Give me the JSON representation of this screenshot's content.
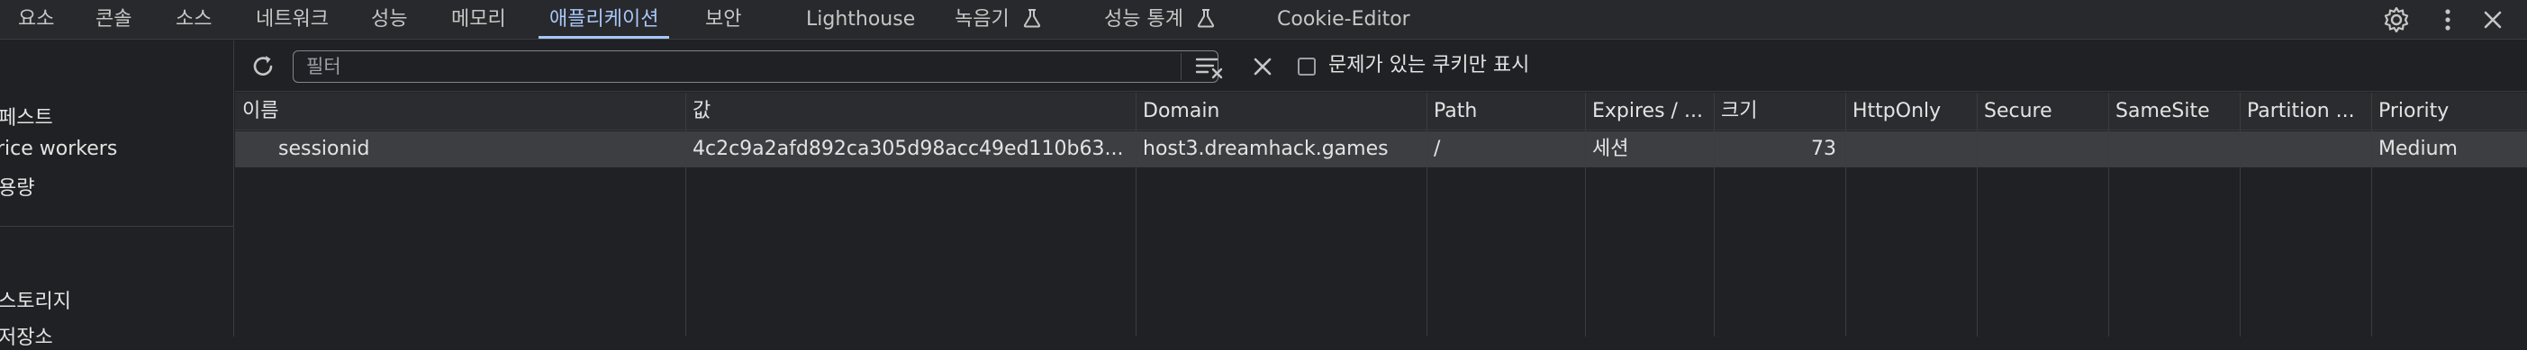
{
  "tabs": [
    {
      "label": "요소"
    },
    {
      "label": "콘솔"
    },
    {
      "label": "소스"
    },
    {
      "label": "네트워크"
    },
    {
      "label": "성능"
    },
    {
      "label": "메모리"
    },
    {
      "label": "애플리케이션",
      "active": true
    },
    {
      "label": "보안"
    },
    {
      "label": "Lighthouse"
    },
    {
      "label": "녹음기"
    },
    {
      "label": "성능 통계"
    },
    {
      "label": "Cookie-Editor"
    }
  ],
  "sidebar": {
    "items": [
      {
        "label": "페스트"
      },
      {
        "label": "rice workers"
      },
      {
        "label": "용량"
      },
      {
        "label": "스토리지"
      },
      {
        "label": "저장소"
      }
    ]
  },
  "toolbar": {
    "filter_placeholder": "필터",
    "filter_value": "",
    "issues_checkbox_label": "문제가 있는 쿠키만 표시",
    "issues_checked": false
  },
  "table": {
    "columns": [
      "이름",
      "값",
      "Domain",
      "Path",
      "Expires / ...",
      "크기",
      "HttpOnly",
      "Secure",
      "SameSite",
      "Partition ...",
      "Priority"
    ],
    "sorted_column": "이름",
    "sort_direction": "ascending",
    "rows": [
      {
        "name": "sessionid",
        "value": "4c2c9a2afd892ca305d98acc49ed110b63...",
        "domain": "host3.dreamhack.games",
        "path": "/",
        "expires": "세션",
        "size": "73",
        "httponly": "",
        "secure": "",
        "samesite": "",
        "partition": "",
        "priority": "Medium"
      }
    ]
  },
  "colors": {
    "background": "#202124",
    "accent": "#a8c7fa",
    "selected_row": "#3d3e42",
    "header": "#2b2c2f"
  }
}
